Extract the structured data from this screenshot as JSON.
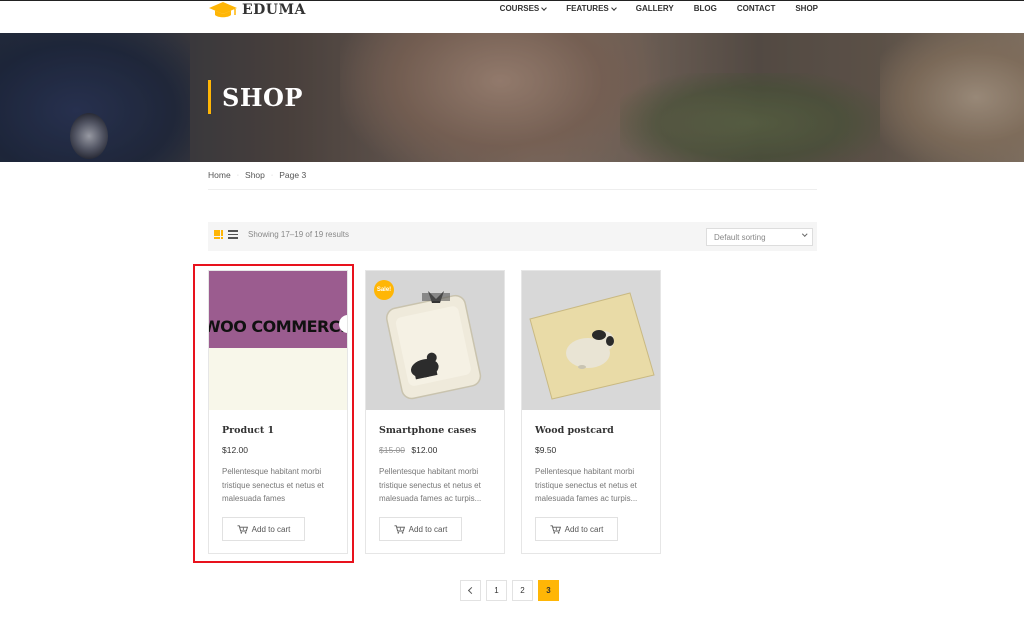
{
  "site": {
    "brand": "EDUMA",
    "accent_color": "#ffb606",
    "highlight_color": "#e8121d"
  },
  "nav": {
    "items": [
      {
        "label": "COURSES",
        "has_dropdown": true
      },
      {
        "label": "FEATURES",
        "has_dropdown": true
      },
      {
        "label": "GALLERY",
        "has_dropdown": false
      },
      {
        "label": "BLOG",
        "has_dropdown": false
      },
      {
        "label": "CONTACT",
        "has_dropdown": false
      },
      {
        "label": "SHOP",
        "has_dropdown": false
      }
    ]
  },
  "hero": {
    "title": "SHOP"
  },
  "breadcrumb": {
    "items": [
      "Home",
      "Shop",
      "Page 3"
    ]
  },
  "toolbar": {
    "result_text": "Showing 17–19 of 19 results",
    "sort_value": "Default sorting"
  },
  "products": [
    {
      "name": "Product 1",
      "price": "$12.00",
      "old_price": "",
      "sale_badge": "",
      "desc_lines": [
        "Pellentesque habitant morbi",
        "tristique senectus et netus et",
        "malesuada fames"
      ],
      "button": "Add to cart",
      "image_text": "WOO COMMERCE",
      "image_color": "#9b5c8f"
    },
    {
      "name": "Smartphone cases",
      "price": "$12.00",
      "old_price": "$15.00",
      "sale_badge": "Sale!",
      "desc_lines": [
        "Pellentesque habitant morbi",
        "tristique senectus et netus et",
        "malesuada fames ac turpis..."
      ],
      "button": "Add to cart",
      "image_text": "",
      "image_color": "#eeeade"
    },
    {
      "name": "Wood postcard",
      "price": "$9.50",
      "old_price": "",
      "sale_badge": "",
      "desc_lines": [
        "Pellentesque habitant morbi",
        "tristique senectus et netus et",
        "malesuada fames ac turpis..."
      ],
      "button": "Add to cart",
      "image_text": "",
      "image_color": "#e9dba7"
    }
  ],
  "pagination": {
    "prev_icon": "chevron-left-icon",
    "pages": [
      "1",
      "2",
      "3"
    ],
    "current": "3"
  }
}
